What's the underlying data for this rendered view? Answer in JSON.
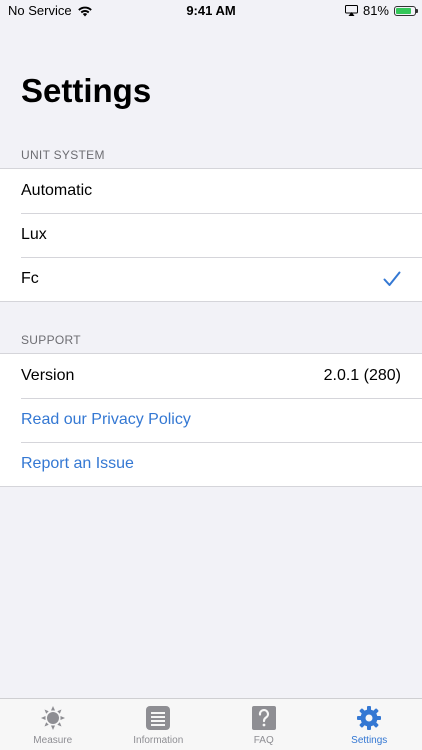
{
  "status_bar": {
    "carrier": "No Service",
    "time": "9:41 AM",
    "battery_percent": "81%",
    "battery_level": 0.81
  },
  "page": {
    "title": "Settings"
  },
  "unit_system": {
    "header": "UNIT SYSTEM",
    "options": [
      {
        "label": "Automatic",
        "selected": false
      },
      {
        "label": "Lux",
        "selected": false
      },
      {
        "label": "Fc",
        "selected": true
      }
    ]
  },
  "support": {
    "header": "SUPPORT",
    "version_label": "Version",
    "version_value": "2.0.1 (280)",
    "privacy_label": "Read our Privacy Policy",
    "report_label": "Report an Issue"
  },
  "tab_bar": {
    "tabs": [
      {
        "label": "Measure",
        "icon": "sun-icon",
        "active": false
      },
      {
        "label": "Information",
        "icon": "list-icon",
        "active": false
      },
      {
        "label": "FAQ",
        "icon": "question-icon",
        "active": false
      },
      {
        "label": "Settings",
        "icon": "gear-icon",
        "active": true
      }
    ]
  },
  "colors": {
    "accent": "#3478d3",
    "background": "#f2f2f7",
    "inactive_tab": "#8e8e93",
    "battery": "#34c759"
  }
}
